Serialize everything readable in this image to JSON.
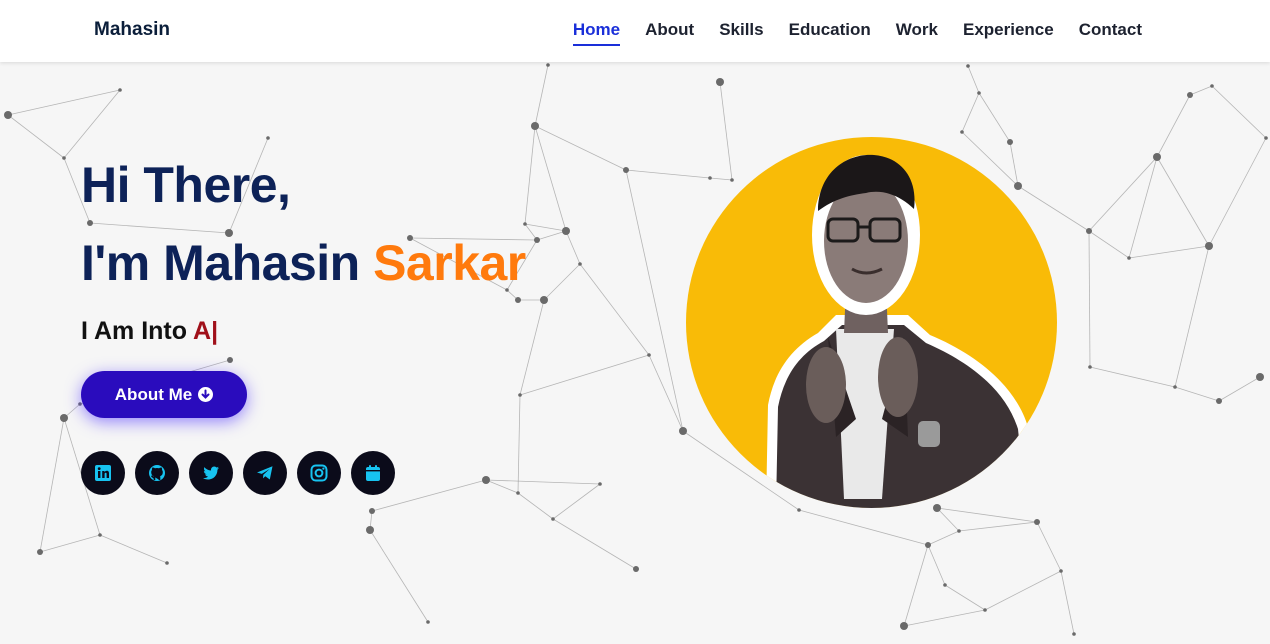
{
  "brand": "Mahasin",
  "nav": [
    "Home",
    "About",
    "Skills",
    "Education",
    "Work",
    "Experience",
    "Contact"
  ],
  "hero": {
    "greeting": "Hi There,",
    "intro_prefix": "I'm Mahasin ",
    "intro_accent": "Sarkar",
    "typed_prefix": "I Am Into ",
    "typed_word": "A|",
    "button_label": "About Me"
  },
  "socials": [
    "linkedin-icon",
    "github-icon",
    "twitter-icon",
    "telegram-icon",
    "instagram-icon",
    "calendar-icon"
  ],
  "colors": {
    "accent": "#ff7a0d",
    "primary": "#0d2258",
    "button": "#2a0cbd",
    "icons": "#17c3f0",
    "photo_bg": "#f9bb07",
    "nav_active": "#1a2fd9"
  }
}
